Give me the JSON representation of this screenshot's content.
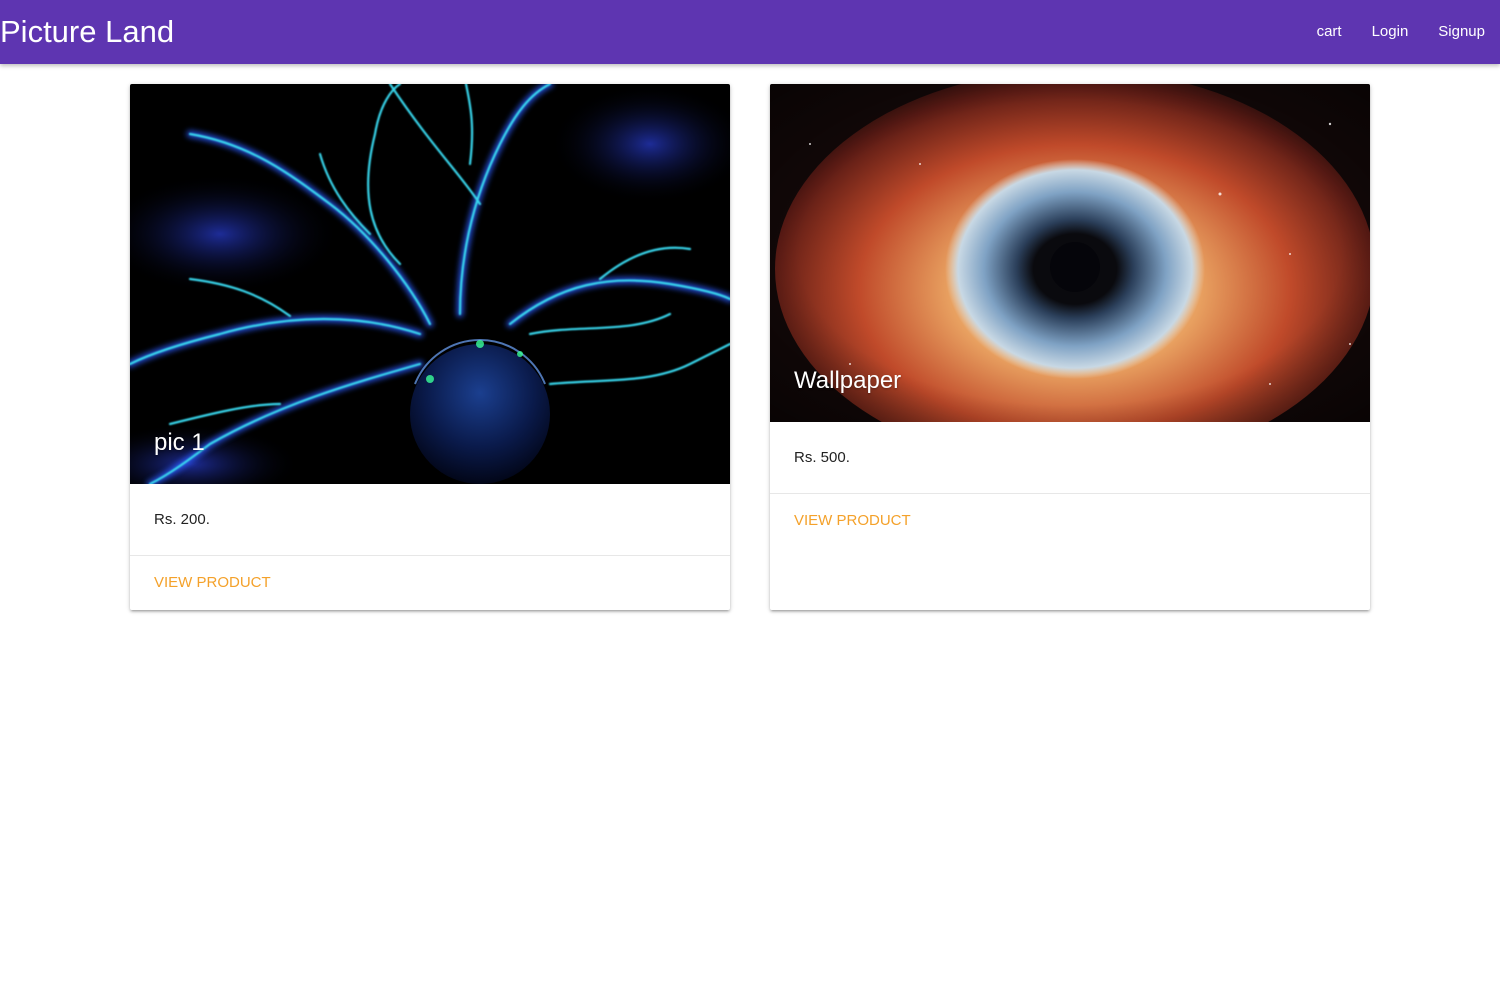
{
  "navbar": {
    "brand": "Picture Land",
    "links": [
      "cart",
      "Login",
      "Signup"
    ],
    "background_color": "#5e35b1"
  },
  "products": [
    {
      "title": "pic 1",
      "price": "Rs. 200.",
      "action_label": "VIEW PRODUCT",
      "image": "plasma-ball-photo"
    },
    {
      "title": "Wallpaper",
      "price": "Rs. 500.",
      "action_label": "VIEW PRODUCT",
      "image": "helix-nebula-eye-photo"
    }
  ],
  "colors": {
    "action_link": "#f4a12a",
    "title_text": "#ffffff"
  }
}
